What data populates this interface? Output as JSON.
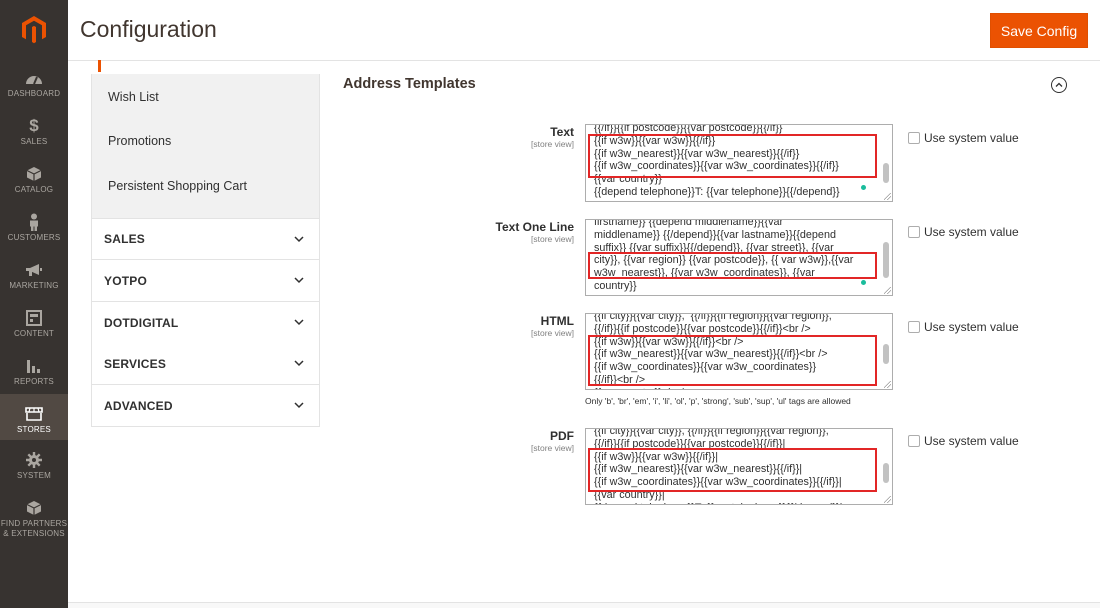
{
  "page": {
    "title": "Configuration",
    "save_label": "Save Config"
  },
  "nav": [
    {
      "label": "DASHBOARD",
      "icon": "dashboard-icon"
    },
    {
      "label": "SALES",
      "icon": "dollar-icon"
    },
    {
      "label": "CATALOG",
      "icon": "box-icon"
    },
    {
      "label": "CUSTOMERS",
      "icon": "person-icon"
    },
    {
      "label": "MARKETING",
      "icon": "megaphone-icon"
    },
    {
      "label": "CONTENT",
      "icon": "layout-icon"
    },
    {
      "label": "REPORTS",
      "icon": "bar-chart-icon"
    },
    {
      "label": "STORES",
      "icon": "store-icon"
    },
    {
      "label": "SYSTEM",
      "icon": "gear-icon"
    },
    {
      "label_line1": "FIND PARTNERS",
      "label_line2": "& EXTENSIONS",
      "icon": "cube-icon"
    }
  ],
  "tabs": {
    "wish_list": "Wish List",
    "promotions": "Promotions",
    "persistent_cart": "Persistent Shopping Cart"
  },
  "sections": {
    "sales": "SALES",
    "yotpo": "YOTPO",
    "dotdigital": "DOTDIGITAL",
    "services": "SERVICES",
    "advanced": "ADVANCED"
  },
  "group": {
    "title": "Address Templates"
  },
  "fields": {
    "scope": "[store view]",
    "use_system": "Use system value",
    "text": {
      "label": "Text",
      "value": "{{/if}}{{if postcode}}{{var postcode}}{{/if}}\n{{if w3w}}{{var w3w}}{{/if}}\n{{if w3w_nearest}}{{var w3w_nearest}}{{/if}}\n{{if w3w_coordinates}}{{var w3w_coordinates}}{{/if}}\n{{var country}}\n{{depend telephone}}T: {{var telephone}}{{/depend}}"
    },
    "text_one_line": {
      "label": "Text One Line",
      "value": "firstname}} {{depend middlename}}{{var\nmiddlename}} {{/depend}}{{var lastname}}{{depend\nsuffix}} {{var suffix}}{{/depend}}, {{var street}}, {{var\ncity}}, {{var region}} {{var postcode}}, {{ var w3w}},{{var\nw3w_nearest}}, {{var w3w_coordinates}}, {{var\ncountry}}"
    },
    "html": {
      "label": "HTML",
      "value": "{{if city}}{{var city}},  {{/if}}{{if region}}{{var region}},\n{{/if}}{{if postcode}}{{var postcode}}{{/if}}<br />\n{{if w3w}}{{var w3w}}{{/if}}<br />\n{{if w3w_nearest}}{{var w3w_nearest}}{{/if}}<br />\n{{if w3w_coordinates}}{{var w3w_coordinates}}\n{{/if}}<br />\n{{var country}}<br />",
      "note": "Only 'b', 'br', 'em', 'i', 'li', 'ol', 'p', 'strong', 'sub', 'sup', 'ul' tags are allowed"
    },
    "pdf": {
      "label": "PDF",
      "value": "{{if city}}{{var city}}, {{/if}}{{if region}}{{var region}},\n{{/if}}{{if postcode}}{{var postcode}}{{/if}}|\n{{if w3w}}{{var w3w}}{{/if}}|\n{{if w3w_nearest}}{{var w3w_nearest}}{{/if}}|\n{{if w3w_coordinates}}{{var w3w_coordinates}}{{/if}}|\n{{var country}}|\n{{depend telephone}}T: {{var telephone}}{{/depend}}|"
    }
  },
  "colors": {
    "accent": "#eb5202",
    "nav_bg": "#373330",
    "highlight": "#e22626"
  }
}
